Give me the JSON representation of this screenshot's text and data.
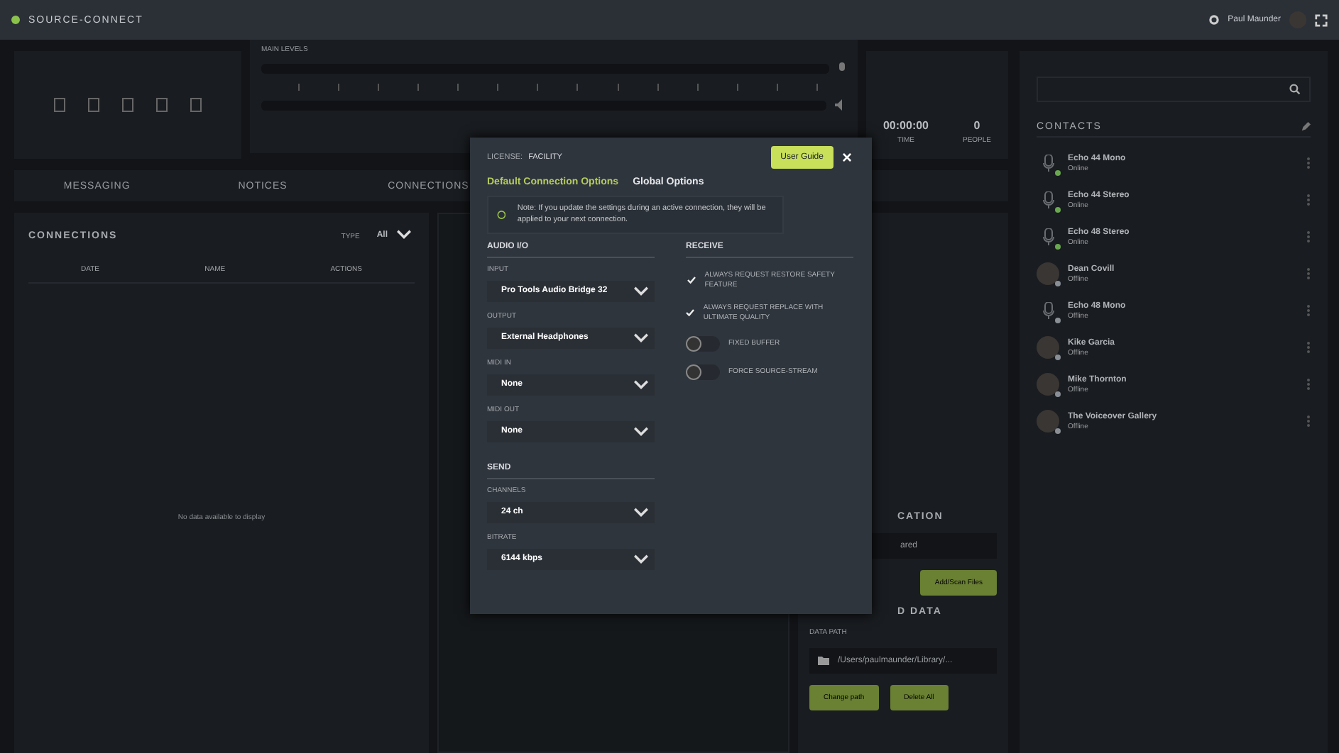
{
  "app": {
    "title": "SOURCE-CONNECT"
  },
  "user": {
    "name": "Paul Maunder"
  },
  "levels": {
    "title": "MAIN LEVELS"
  },
  "stats": [
    {
      "value": "00:00:00",
      "label": "TIME"
    },
    {
      "value": "0",
      "label": "PEOPLE"
    }
  ],
  "main_tabs": [
    {
      "label": "MESSAGING",
      "selected": false
    },
    {
      "label": "NOTICES",
      "selected": false
    },
    {
      "label": "CONNECTIONS",
      "selected": false
    }
  ],
  "connections": {
    "title": "CONNECTIONS",
    "type_label": "TYPE",
    "type_value": "All",
    "columns": [
      "DATE",
      "NAME",
      "ACTIONS"
    ],
    "empty": "No data available to display"
  },
  "location": {
    "title": "CATION",
    "field": "ared",
    "button": "Add/Scan Files"
  },
  "storage": {
    "title": "D DATA",
    "path_label": "DATA PATH",
    "path": "/Users/paulmaunder/Library/...",
    "buttons": [
      "Change path",
      "Delete All"
    ]
  },
  "contacts": {
    "title": "CONTACTS",
    "items": [
      {
        "name": "Echo 44 Mono",
        "status": "Online",
        "kind": "device",
        "color": "#6aa84f"
      },
      {
        "name": "Echo 44 Stereo",
        "status": "Online",
        "kind": "device",
        "color": "#6aa84f"
      },
      {
        "name": "Echo 48 Stereo",
        "status": "Online",
        "kind": "device",
        "color": "#6aa84f"
      },
      {
        "name": "Dean Covill",
        "status": "Offline",
        "kind": "person",
        "color": "#8a8f96"
      },
      {
        "name": "Echo 48 Mono",
        "status": "Offline",
        "kind": "device",
        "color": "#8a8f96"
      },
      {
        "name": "Kike Garcia",
        "status": "Offline",
        "kind": "person",
        "color": "#8a8f96"
      },
      {
        "name": "Mike Thornton",
        "status": "Offline",
        "kind": "person",
        "color": "#8a8f96"
      },
      {
        "name": "The Voiceover Gallery",
        "status": "Offline",
        "kind": "person",
        "color": "#8a8f96"
      }
    ]
  },
  "dialog": {
    "license_label": "LICENSE:",
    "license": "FACILITY",
    "guide_button": "User Guide",
    "close": "×",
    "tabs": [
      {
        "label": "Default Connection Options",
        "selected": true
      },
      {
        "label": "Global Options",
        "selected": false
      }
    ],
    "note": "Note: If you update the settings during an active connection, they will be applied to your next connection.",
    "audio": {
      "title": "AUDIO I/O",
      "fields": [
        {
          "label": "INPUT",
          "value": "Pro Tools Audio Bridge 32"
        },
        {
          "label": "OUTPUT",
          "value": "External Headphones"
        },
        {
          "label": "MIDI IN",
          "value": "None"
        },
        {
          "label": "MIDI OUT",
          "value": "None"
        }
      ]
    },
    "send": {
      "title": "SEND",
      "fields": [
        {
          "label": "CHANNELS",
          "value": "24 ch"
        },
        {
          "label": "BITRATE",
          "value": "6144 kbps"
        }
      ]
    },
    "receive": {
      "title": "RECEIVE",
      "options": [
        {
          "kind": "check",
          "label": "ALWAYS REQUEST RESTORE SAFETY FEATURE",
          "on": true
        },
        {
          "kind": "check",
          "label": "ALWAYS REQUEST REPLACE WITH ULTIMATE QUALITY",
          "on": true
        },
        {
          "kind": "toggle",
          "label": "FIXED BUFFER",
          "on": false
        },
        {
          "kind": "toggle",
          "label": "FORCE SOURCE-STREAM",
          "on": false
        }
      ]
    }
  }
}
